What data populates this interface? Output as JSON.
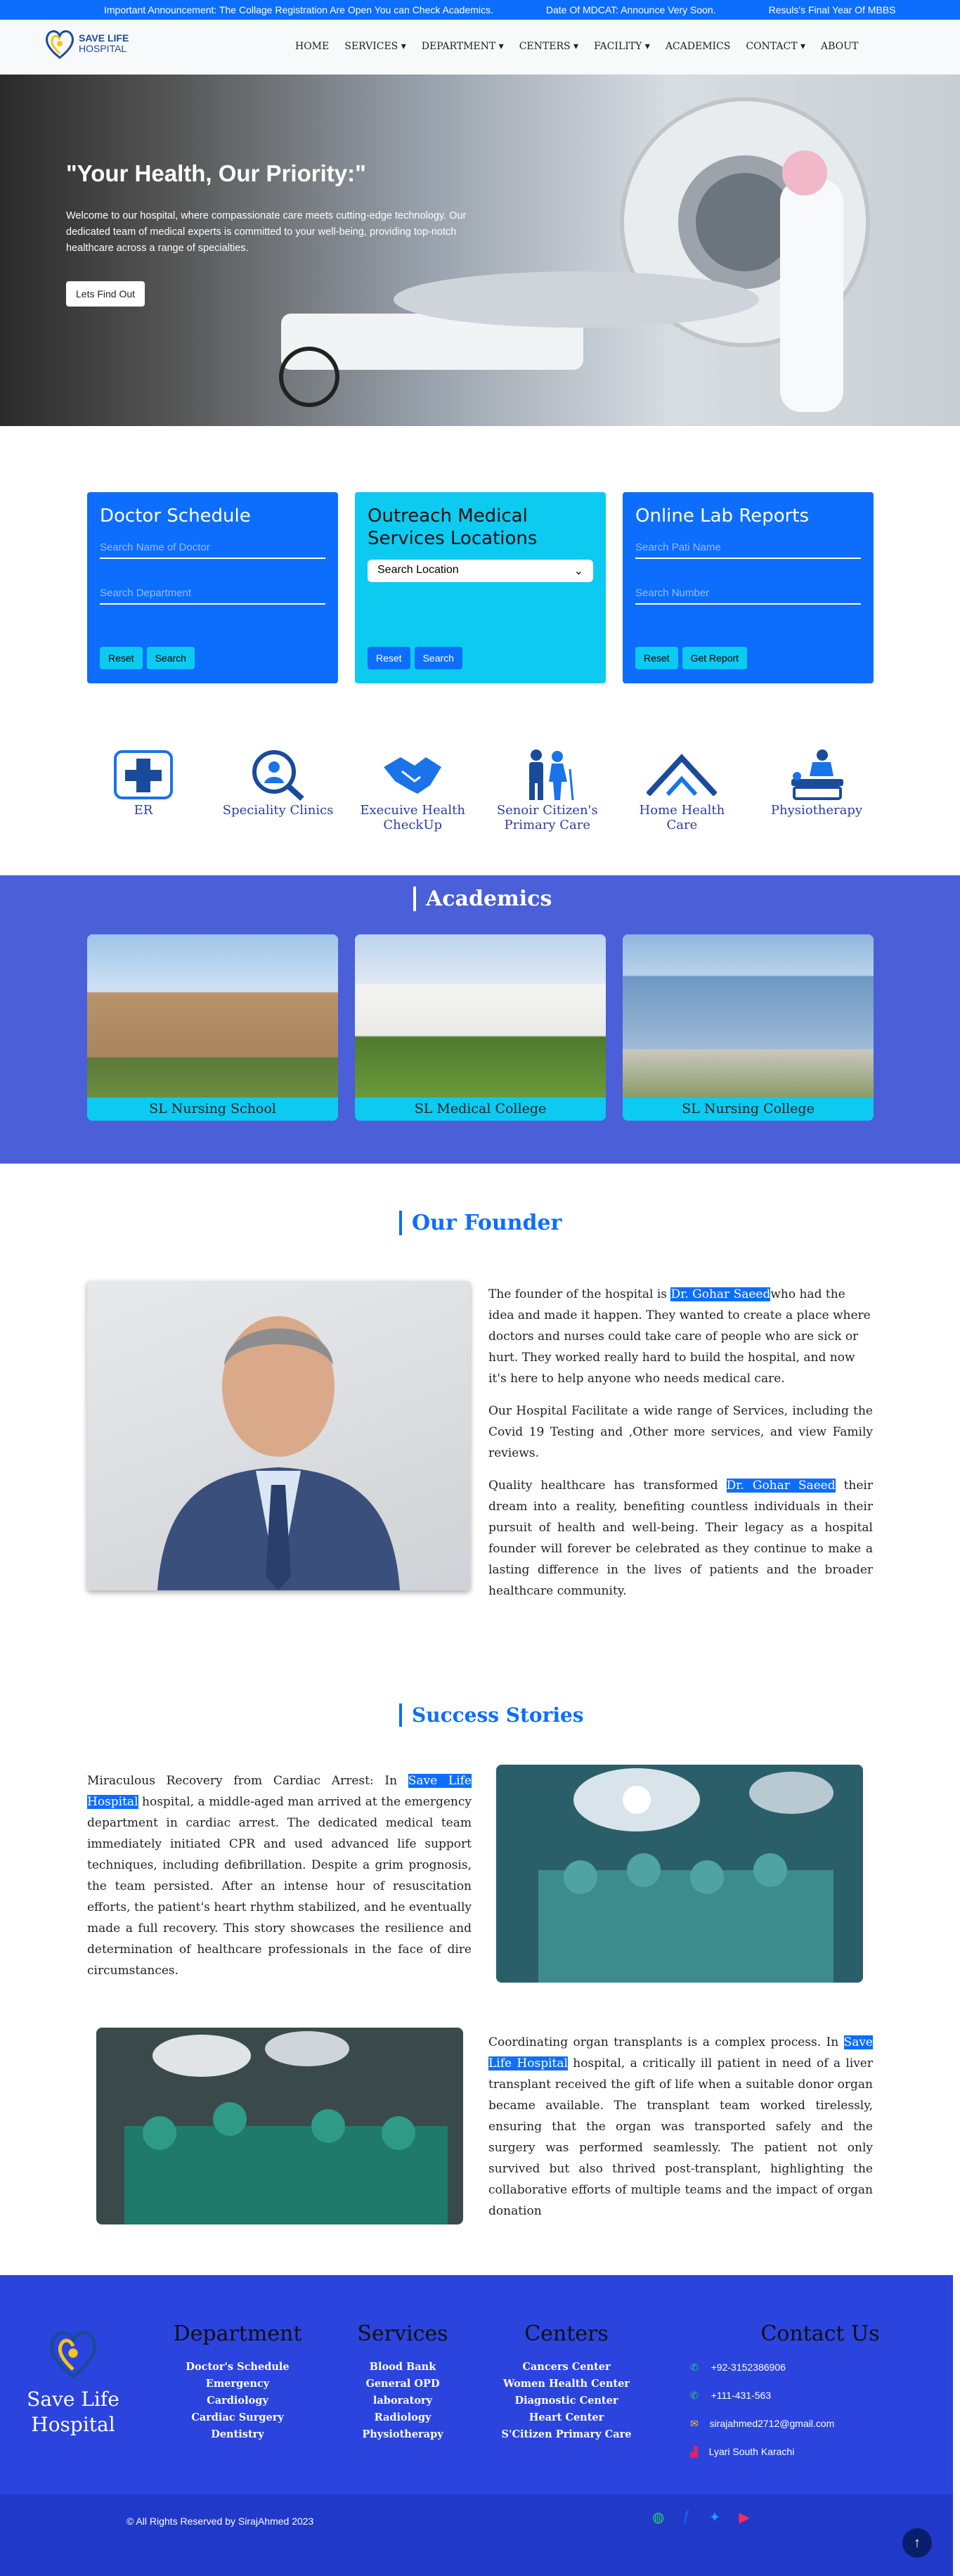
{
  "ticker": [
    "Important Announcement: The Collage Registration Are Open You can Check Academics.",
    "Date Of MDCAT: Announce Very Soon.",
    "Resuls's Final Year Of MBBS"
  ],
  "brand": {
    "line1": "SAVE LIFE",
    "line2": "HOSPITAL"
  },
  "nav": [
    "HOME",
    "SERVICES",
    "DEPARTMENT",
    "CENTERS",
    "FACILITY",
    "ACADEMICS",
    "CONTACT",
    "ABOUT"
  ],
  "hero": {
    "title": "\"Your Health, Our Priority:\"",
    "text": "Welcome to our hospital, where compassionate care meets cutting-edge technology. Our dedicated team of medical experts is committed to your well-being, providing top-notch healthcare across a range of specialties.",
    "button": "Lets Find Out"
  },
  "doctor": {
    "title": "Doctor Schedule",
    "ph1": "Search Name of Doctor",
    "ph2": "Search Department",
    "reset": "Reset",
    "search": "Search"
  },
  "outreach": {
    "title": "Outreach Medical Services Locations",
    "select": "Search Location",
    "reset": "Reset",
    "search": "Search"
  },
  "lab": {
    "title": "Online Lab Reports",
    "ph1": "Search Pati Name",
    "ph2": "Search Number",
    "reset": "Reset",
    "report": "Get Report"
  },
  "services": [
    "ER",
    "Speciality Clinics",
    "Execuive Health CheckUp",
    "Senoir Citizen's Primary Care",
    "Home Health Care",
    "Physiotherapy"
  ],
  "academics": {
    "title": "Academics",
    "items": [
      "SL Nursing School",
      "SL Medical College",
      "SL Nursing College"
    ]
  },
  "founder": {
    "title": "Our Founder",
    "name": "Dr. Gohar Saeed",
    "p1a": "The founder of the hospital is ",
    "p1b": "who had the idea and made it happen. They wanted to create a place where doctors and nurses could take care of people who are sick or hurt. They worked really hard to build the hospital, and now it's here to help anyone who needs medical care.",
    "p2": "Our Hospital Facilitate a wide range of Services, including the Covid 19 Testing and ,Other more services, and view Family reviews.",
    "p3a": "Quality healthcare has transformed ",
    "p3b": " their dream into a reality, benefiting countless individuals in their pursuit of health and well-being. Their legacy as a hospital founder will forever be celebrated as they continue to make a lasting difference in the lives of patients and the broader healthcare community."
  },
  "stories": {
    "title": "Success Stories",
    "hospital": "Save Life Hospital",
    "s1a": "Miraculous Recovery from Cardiac Arrest: In ",
    "s1b": " hospital, a middle-aged man arrived at the emergency department in cardiac arrest. The dedicated medical team immediately initiated CPR and used advanced life support techniques, including defibrillation. Despite a grim prognosis, the team persisted. After an intense hour of resuscitation efforts, the patient's heart rhythm stabilized, and he eventually made a full recovery. This story showcases the resilience and determination of healthcare professionals in the face of dire circumstances.",
    "s2a": "Coordinating organ transplants is a complex process. In ",
    "s2b": " hospital, a critically ill patient in need of a liver transplant received the gift of life when a suitable donor organ became available. The transplant team worked tirelessly, ensuring that the organ was transported safely and the surgery was performed seamlessly. The patient not only survived but also thrived post-transplant, highlighting the collaborative efforts of multiple teams and the impact of organ donation"
  },
  "footer": {
    "brand": "Save Life Hospital",
    "department": {
      "title": "Department",
      "items": [
        "Doctor's Schedule",
        "Emergency",
        "Cardiology",
        "Cardiac Surgery",
        "Dentistry"
      ]
    },
    "services": {
      "title": "Services",
      "items": [
        "Blood Bank",
        "General OPD",
        "laboratory",
        "Radiology",
        "Physiotherapy"
      ]
    },
    "centers": {
      "title": "Centers",
      "items": [
        "Cancers Center",
        "Women Health Center",
        "Diagnostic Center",
        "Heart Center",
        "S'Citizen Primary Care"
      ]
    },
    "contact": {
      "title": "Contact Us",
      "phone1": "+92-3152386906",
      "phone2": "+111-431-563",
      "email": "sirajahmed2712@gmail.com",
      "address": "Lyari South Karachi"
    },
    "copyright": "© All Rights  Reserved by SirajAhmed 2023"
  }
}
